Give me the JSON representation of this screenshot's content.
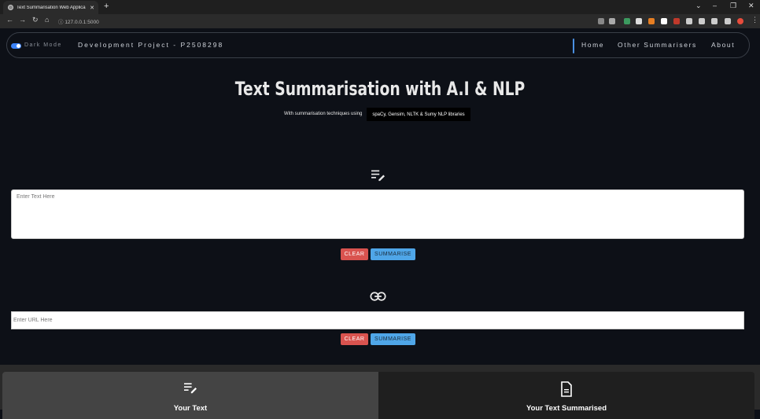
{
  "browser": {
    "tab_title": "Text Summarisation Web Applica",
    "tab_close": "✕",
    "new_tab": "+",
    "url": "127.0.0.1:5000"
  },
  "navbar": {
    "dark_mode_label": "Dark Mode",
    "brand": "Development Project - P2508298",
    "links": [
      "Home",
      "Other Summarisers",
      "About"
    ]
  },
  "hero": {
    "title": "Text Summarisation with A.I & NLP",
    "subtitle": "With summarisation techniques using",
    "libraries": "spaCy, Gensim, NLTK & Sumy NLP libraries"
  },
  "text_section": {
    "icon": "edit-note-icon",
    "placeholder": "Enter Text Here",
    "clear_label": "CLEAR",
    "summarise_label": "SUMMARISE"
  },
  "url_section": {
    "icon": "link-icon",
    "placeholder": "Enter URL Here",
    "clear_label": "CLEAR",
    "summarise_label": "SUMMARISE"
  },
  "results": {
    "left_label": "Your Text",
    "left_icon": "edit-note-icon",
    "right_label": "Your Text Summarised",
    "right_icon": "document-icon"
  },
  "colors": {
    "background": "#0d1017",
    "clear": "#d9534f",
    "summarise": "#4fa6e8",
    "toggle": "#3b82f6"
  }
}
